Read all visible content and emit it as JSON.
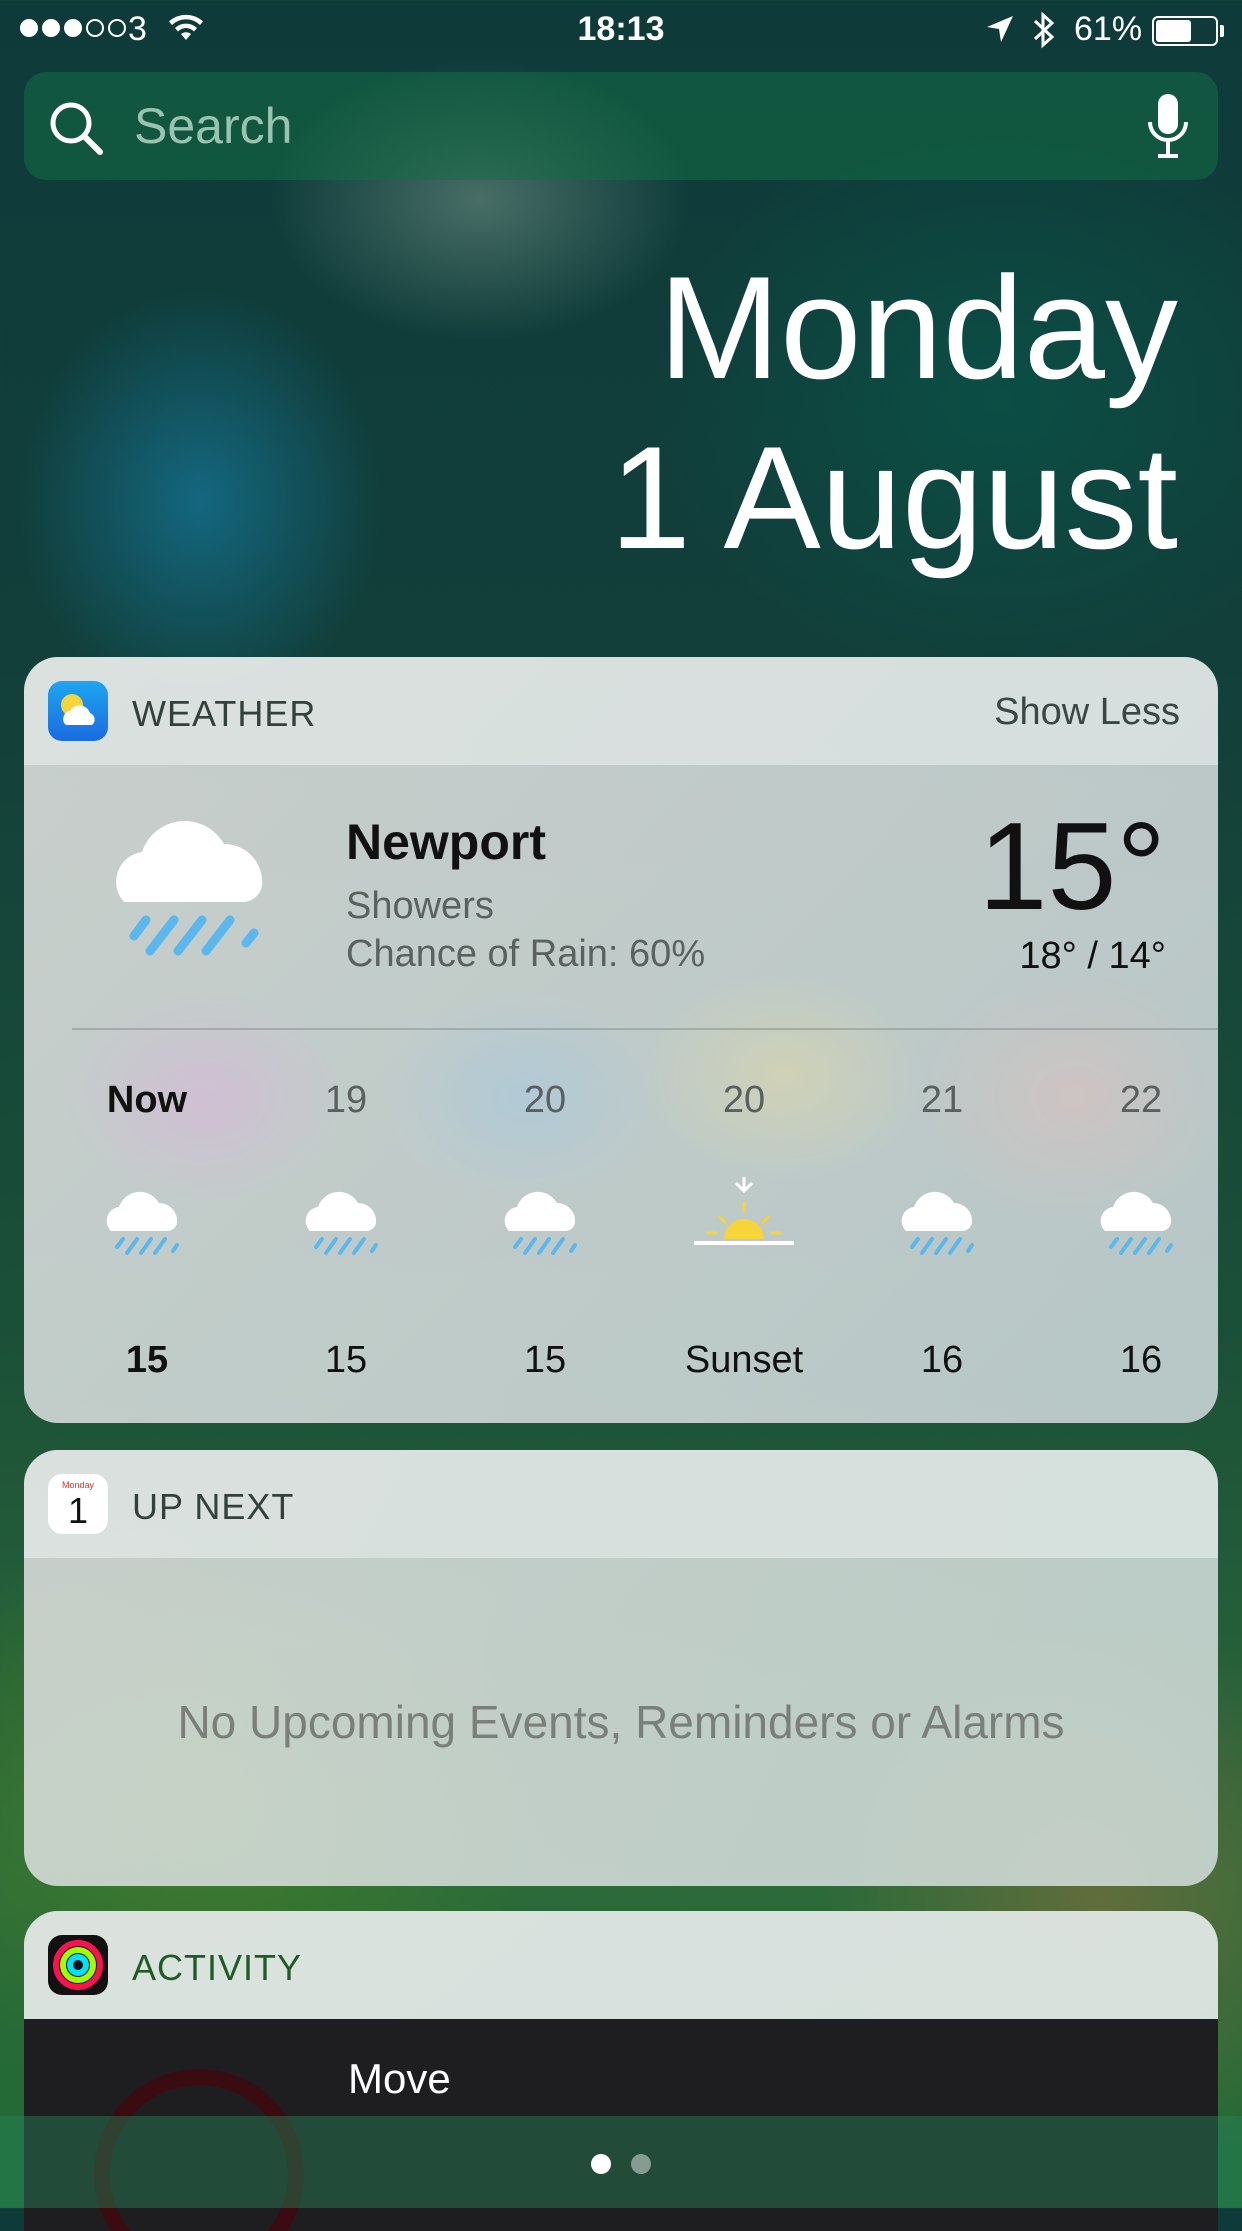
{
  "status": {
    "carrier": "3",
    "time": "18:13",
    "battery_percent": "61%",
    "battery_level": 0.61,
    "signal_bars": [
      true,
      true,
      true,
      false,
      false
    ]
  },
  "search": {
    "placeholder": "Search"
  },
  "date": {
    "weekday": "Monday",
    "day_month": "1 August"
  },
  "weather": {
    "title": "WEATHER",
    "action": "Show Less",
    "city": "Newport",
    "condition": "Showers",
    "rain_chance": "Chance of Rain: 60%",
    "temperature": "15°",
    "hi_lo": "18° / 14°",
    "hourly": [
      {
        "label": "Now",
        "icon": "rain-cloud-icon",
        "temp": "15"
      },
      {
        "label": "19",
        "icon": "rain-cloud-icon",
        "temp": "15"
      },
      {
        "label": "20",
        "icon": "rain-cloud-icon",
        "temp": "15"
      },
      {
        "label": "20",
        "icon": "sunset-icon",
        "temp": "Sunset"
      },
      {
        "label": "21",
        "icon": "rain-cloud-icon",
        "temp": "16"
      },
      {
        "label": "22",
        "icon": "rain-cloud-icon",
        "temp": "16"
      }
    ]
  },
  "upnext": {
    "title": "UP NEXT",
    "icon_month": "Monday",
    "icon_day": "1",
    "empty_message": "No Upcoming Events, Reminders or Alarms"
  },
  "activity": {
    "title": "ACTIVITY",
    "move_label": "Move"
  },
  "page_dots": {
    "count": 2,
    "active": 0
  },
  "colors": {
    "rain_blue": "#5ab8ee",
    "sun_yellow": "#f7d43a",
    "calendar_red": "#e5332b"
  }
}
